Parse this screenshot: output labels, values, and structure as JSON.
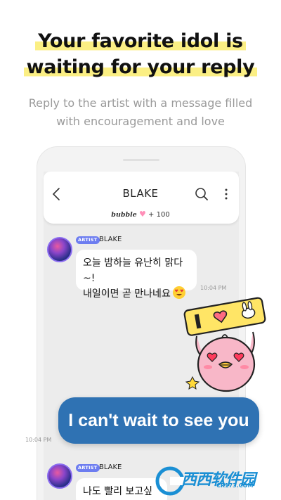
{
  "headline": {
    "line1": "Your favorite idol is",
    "line2": "waiting for your reply"
  },
  "subtitle": {
    "line1": "Reply to the artist with a message filled",
    "line2": "with encouragement and love"
  },
  "chat": {
    "title": "BLAKE",
    "bubble_brand": "bubble",
    "bubble_count": "+ 100",
    "messages": [
      {
        "badge": "ARTIST",
        "sender": "BLAKE",
        "line1": "오늘 밤하늘 유난히 맑다~!",
        "line2": "내일이면 곧 만나네요",
        "time": "10:04 PM"
      },
      {
        "badge": "ARTIST",
        "sender": "BLAKE",
        "line1": "나도 빨리 보고싶다~"
      }
    ],
    "my_message": {
      "text": "I can't wait to see you",
      "time": "10:04 PM"
    }
  },
  "watermark": {
    "text": "西西软件园",
    "sub": "CR173.COM"
  },
  "colors": {
    "highlight": "#fbef84",
    "my_bubble": "#2f72b3",
    "artist_badge": "#6d7df0",
    "sticker_pink": "#f8b7c8"
  }
}
